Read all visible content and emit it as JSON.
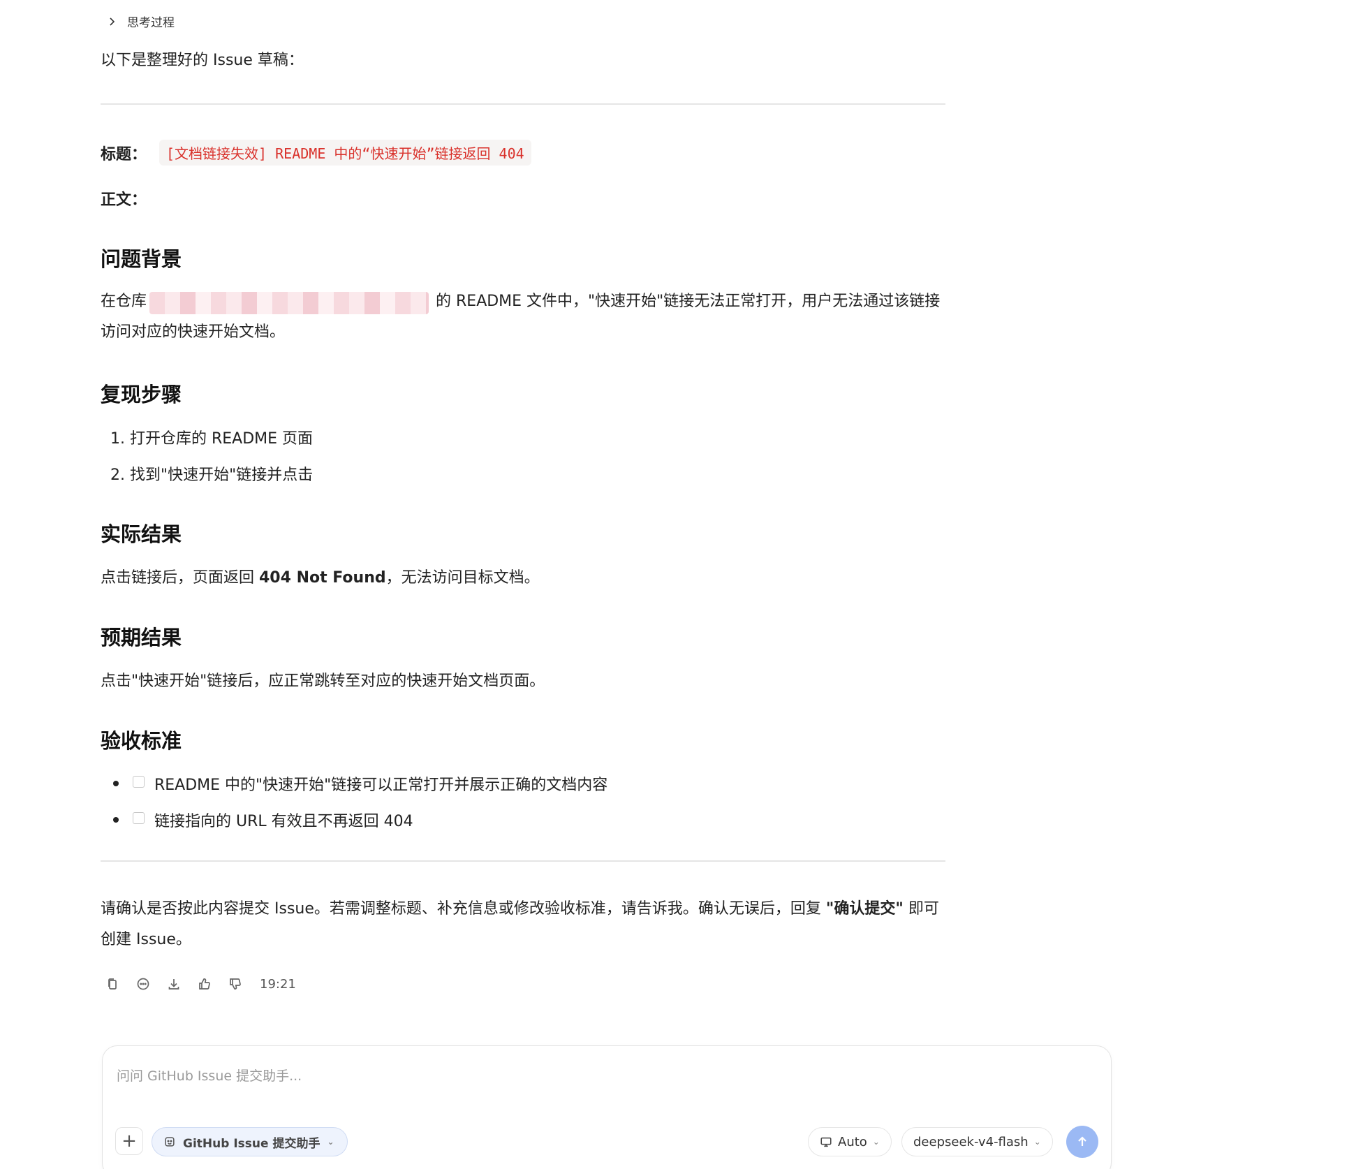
{
  "message": {
    "thinking_label": "思考过程",
    "intro": "以下是整理好的 Issue 草稿：",
    "title_label": "标题：",
    "title_code": "[文档链接失效] README 中的“快速开始”链接返回 404",
    "body_label": "正文：",
    "sections": {
      "background": {
        "heading": "问题背景",
        "text_before": "在仓库",
        "text_after": "的 README 文件中，\"快速开始\"链接无法正常打开，用户无法通过该链接访问对应的快速开始文档。"
      },
      "steps": {
        "heading": "复现步骤",
        "items": [
          "1. 打开仓库的 README 页面",
          "2. 找到\"快速开始\"链接并点击"
        ]
      },
      "actual": {
        "heading": "实际结果",
        "text_before": "点击链接后，页面返回 ",
        "bold": "404 Not Found",
        "text_after": "，无法访问目标文档。"
      },
      "expected": {
        "heading": "预期结果",
        "text": "点击\"快速开始\"链接后，应正常跳转至对应的快速开始文档页面。"
      },
      "acceptance": {
        "heading": "验收标准",
        "items": [
          "README 中的\"快速开始\"链接可以正常打开并展示正确的文档内容",
          "链接指向的 URL 有效且不再返回 404"
        ]
      }
    },
    "confirm": {
      "text_before": "请确认是否按此内容提交 Issue。若需调整标题、补充信息或修改验收标准，请告诉我。确认无误后，回复 ",
      "bold": "\"确认提交\"",
      "text_after": " 即可创建 Issue。"
    },
    "timestamp": "19:21"
  },
  "composer": {
    "placeholder": "问问 GitHub Issue 提交助手...",
    "plus": "+",
    "agent_label": "GitHub Issue 提交助手",
    "mode_label": "Auto",
    "model_label": "deepseek-v4-flash",
    "accent": "#9bb9f4"
  }
}
